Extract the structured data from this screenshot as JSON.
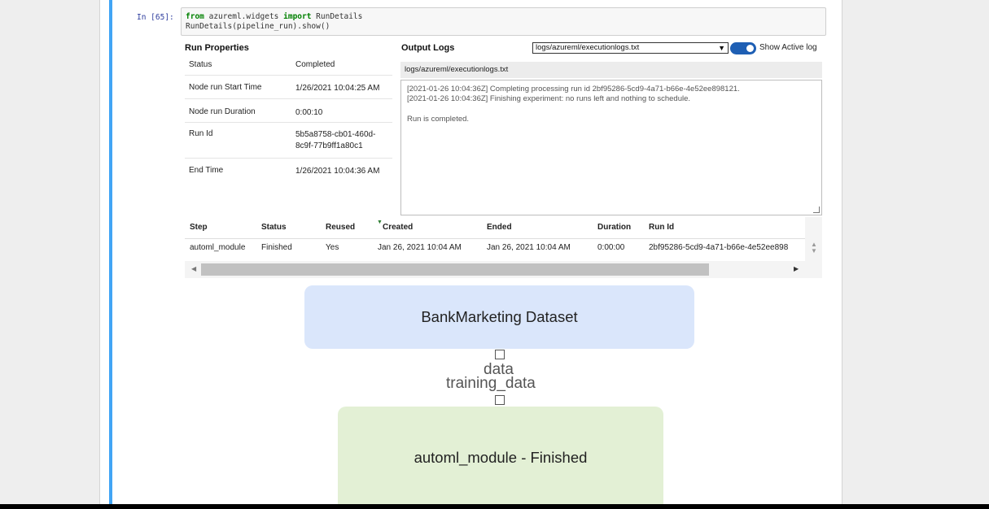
{
  "cell": {
    "prompt": "In [65]:",
    "code": {
      "kw_from": "from",
      "module": " azureml.widgets ",
      "kw_import": "import",
      "name": " RunDetails",
      "line2": "RunDetails(pipeline_run).show()"
    }
  },
  "run_properties": {
    "title": "Run Properties",
    "rows": [
      {
        "key": "Status",
        "value": "Completed"
      },
      {
        "key": "Node run Start Time",
        "value": "1/26/2021 10:04:25 AM"
      },
      {
        "key": "Node run Duration",
        "value": "0:00:10"
      },
      {
        "key": "Run Id",
        "value": "5b5a8758-cb01-460d-8c9f-77b9ff1a80c1"
      },
      {
        "key": "End Time",
        "value": "1/26/2021 10:04:36 AM"
      }
    ]
  },
  "output_logs": {
    "title": "Output Logs",
    "selected_file": "logs/azureml/executionlogs.txt",
    "toggle_label": "Show Active log",
    "toggle_on": true,
    "header": "logs/azureml/executionlogs.txt",
    "lines": [
      "[2021-01-26 10:04:36Z] Completing processing run id 2bf95286-5cd9-4a71-b66e-4e52ee898121.",
      "[2021-01-26 10:04:36Z] Finishing experiment: no runs left and nothing to schedule.",
      "",
      "Run is completed."
    ]
  },
  "steps_table": {
    "columns": [
      "Step",
      "Status",
      "Reused",
      "Created",
      "Ended",
      "Duration",
      "Run Id"
    ],
    "rows": [
      [
        "automl_module",
        "Finished",
        "Yes",
        "Jan 26, 2021 10:04 AM",
        "Jan 26, 2021 10:04 AM",
        "0:00:00",
        "2bf95286-5cd9-4a71-b66e-4e52ee898"
      ]
    ]
  },
  "graph": {
    "dataset_node": "BankMarketing Dataset",
    "edge_labels": [
      "data",
      "training_data"
    ],
    "module_node": "automl_module - Finished"
  },
  "colors": {
    "accent": "#1e5fb4",
    "cell_bar": "#42a5f5",
    "dataset_node": "#dae6fb",
    "module_node": "#e3f0d5"
  }
}
